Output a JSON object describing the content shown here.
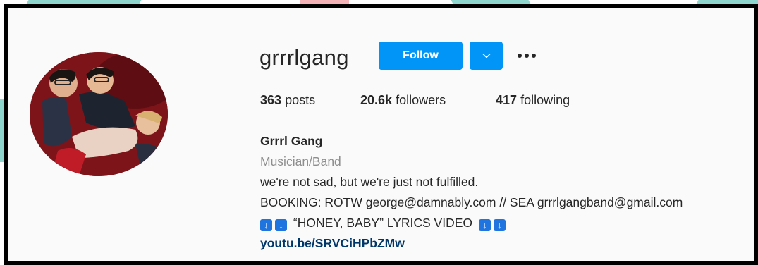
{
  "profile": {
    "username": "grrrlgang",
    "follow_label": "Follow",
    "stats": {
      "posts_count": "363",
      "posts_label": "posts",
      "followers_count": "20.6k",
      "followers_label": "followers",
      "following_count": "417",
      "following_label": "following"
    },
    "bio": {
      "name": "Grrrl Gang",
      "category": "Musician/Band",
      "tagline": "we're not sad, but we're just not fulfilled.",
      "booking": "BOOKING: ROTW george@damnably.com // SEA grrrlgangband@gmail.com",
      "video_text": "“HONEY, BABY” LYRICS VIDEO",
      "link": "youtu.be/SRVCiHPbZMw"
    }
  },
  "icons": {
    "dropdown": "chevron-down-icon",
    "more": "more-options-icon",
    "arrow": "down-arrow-emoji"
  },
  "colors": {
    "primary": "#0095f6",
    "text": "#262626",
    "muted": "#8e8e8e",
    "link": "#00376b"
  }
}
